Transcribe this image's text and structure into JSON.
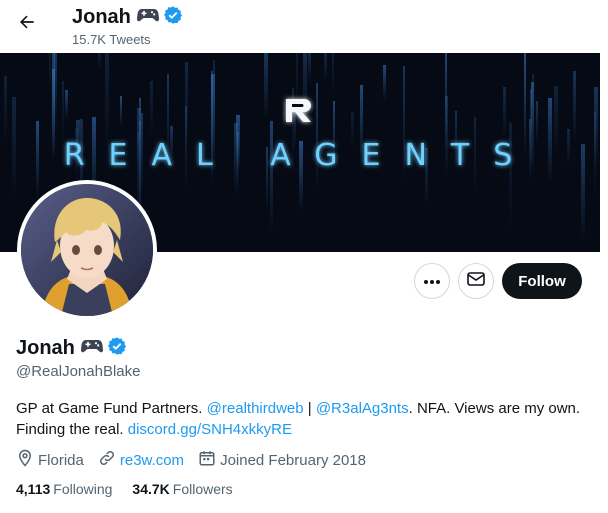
{
  "header": {
    "name": "Jonah",
    "tweets_count": "15.7K Tweets"
  },
  "banner": {
    "logo_letter": "R",
    "text": "REAL AGENTS"
  },
  "actions": {
    "more_label": "•••",
    "follow_label": "Follow"
  },
  "profile": {
    "name": "Jonah",
    "handle": "@RealJonahBlake",
    "bio": {
      "part1": "GP at Game Fund Partners. ",
      "mention1": "@realthirdweb",
      "sep": " | ",
      "mention2": "@R3alAg3nts",
      "part2": ". NFA. Views are my own.",
      "part3": "Finding the real. ",
      "link": "discord.gg/SNH4xkkyRE"
    },
    "location": "Florida",
    "website": "re3w.com",
    "joined": "Joined February 2018",
    "following_count": "4,113",
    "following_label": "Following",
    "followers_count": "34.7K",
    "followers_label": "Followers"
  },
  "icons": [
    "back-arrow-icon",
    "gamepad-icon",
    "verified-badge-icon",
    "more-icon",
    "mail-icon",
    "location-icon",
    "link-icon",
    "calendar-icon"
  ],
  "colors": {
    "accent": "#1d9bf0",
    "text": "#0f1419",
    "muted": "#536471",
    "follow_bg": "#0f1419",
    "banner_bg": "#050a14",
    "banner_glow": "#5ec8ff"
  }
}
